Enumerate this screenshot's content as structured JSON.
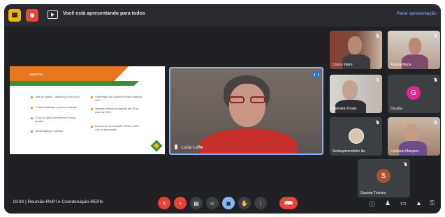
{
  "topbar": {
    "presenting_text": "Você está apresentando para todos",
    "stop_presenting": "Parar apresentação"
  },
  "slide": {
    "title": "OBJETIVO",
    "bullets_left": [
      "Lista de tópicos – agenda do texto do PI",
      "31 dias dedicados à primeira reflexão",
      "Curva ao último semestre a PI neste período",
      "Manter diálogo e debater."
    ],
    "bullets_right": [
      "Celebração das 4 anos do Plano Nacional da PI",
      "Sessões abertas ao consulta até 25 de junho de 2019",
      "Período de consolidação 29/06 a 15/08 com os associados"
    ]
  },
  "main_speaker": {
    "name": "Lucie Loffle"
  },
  "participants": [
    {
      "name": "Cicero Vieira",
      "avatar_letter": "",
      "avatar_color": ""
    },
    {
      "name": "Angela Maria",
      "avatar_letter": "",
      "avatar_color": ""
    },
    {
      "name": "Reinaldo Prado",
      "avatar_letter": "",
      "avatar_color": ""
    },
    {
      "name": "Óscyka",
      "avatar_letter": "G",
      "avatar_color": "#e52592"
    },
    {
      "name": "Sertaquimentinho Ita",
      "avatar_letter": "",
      "avatar_color": ""
    },
    {
      "name": "Cristiane Marques",
      "avatar_letter": "",
      "avatar_color": ""
    },
    {
      "name": "Suporte Técnico",
      "avatar_letter": "S",
      "avatar_color": "#a65335"
    }
  ],
  "bottombar": {
    "time": "19:34",
    "separator": "|",
    "meeting_title": "Reunião RNPI e Coordenação REPIs"
  },
  "icons": {
    "controls": [
      "mic-off-icon",
      "camera-off-icon",
      "captions-icon",
      "emoji-icon",
      "present-icon",
      "raise-hand-icon",
      "more-options-icon",
      "end-call-icon"
    ],
    "right": [
      "info-icon",
      "people-icon",
      "chat-icon",
      "activities-icon",
      "lock-icon"
    ]
  },
  "colors": {
    "background": "#202124",
    "accent_blue": "#8ab4f8",
    "control_red": "#ea4335",
    "slide_orange": "#e87722",
    "slide_green": "#3a8f3a"
  }
}
